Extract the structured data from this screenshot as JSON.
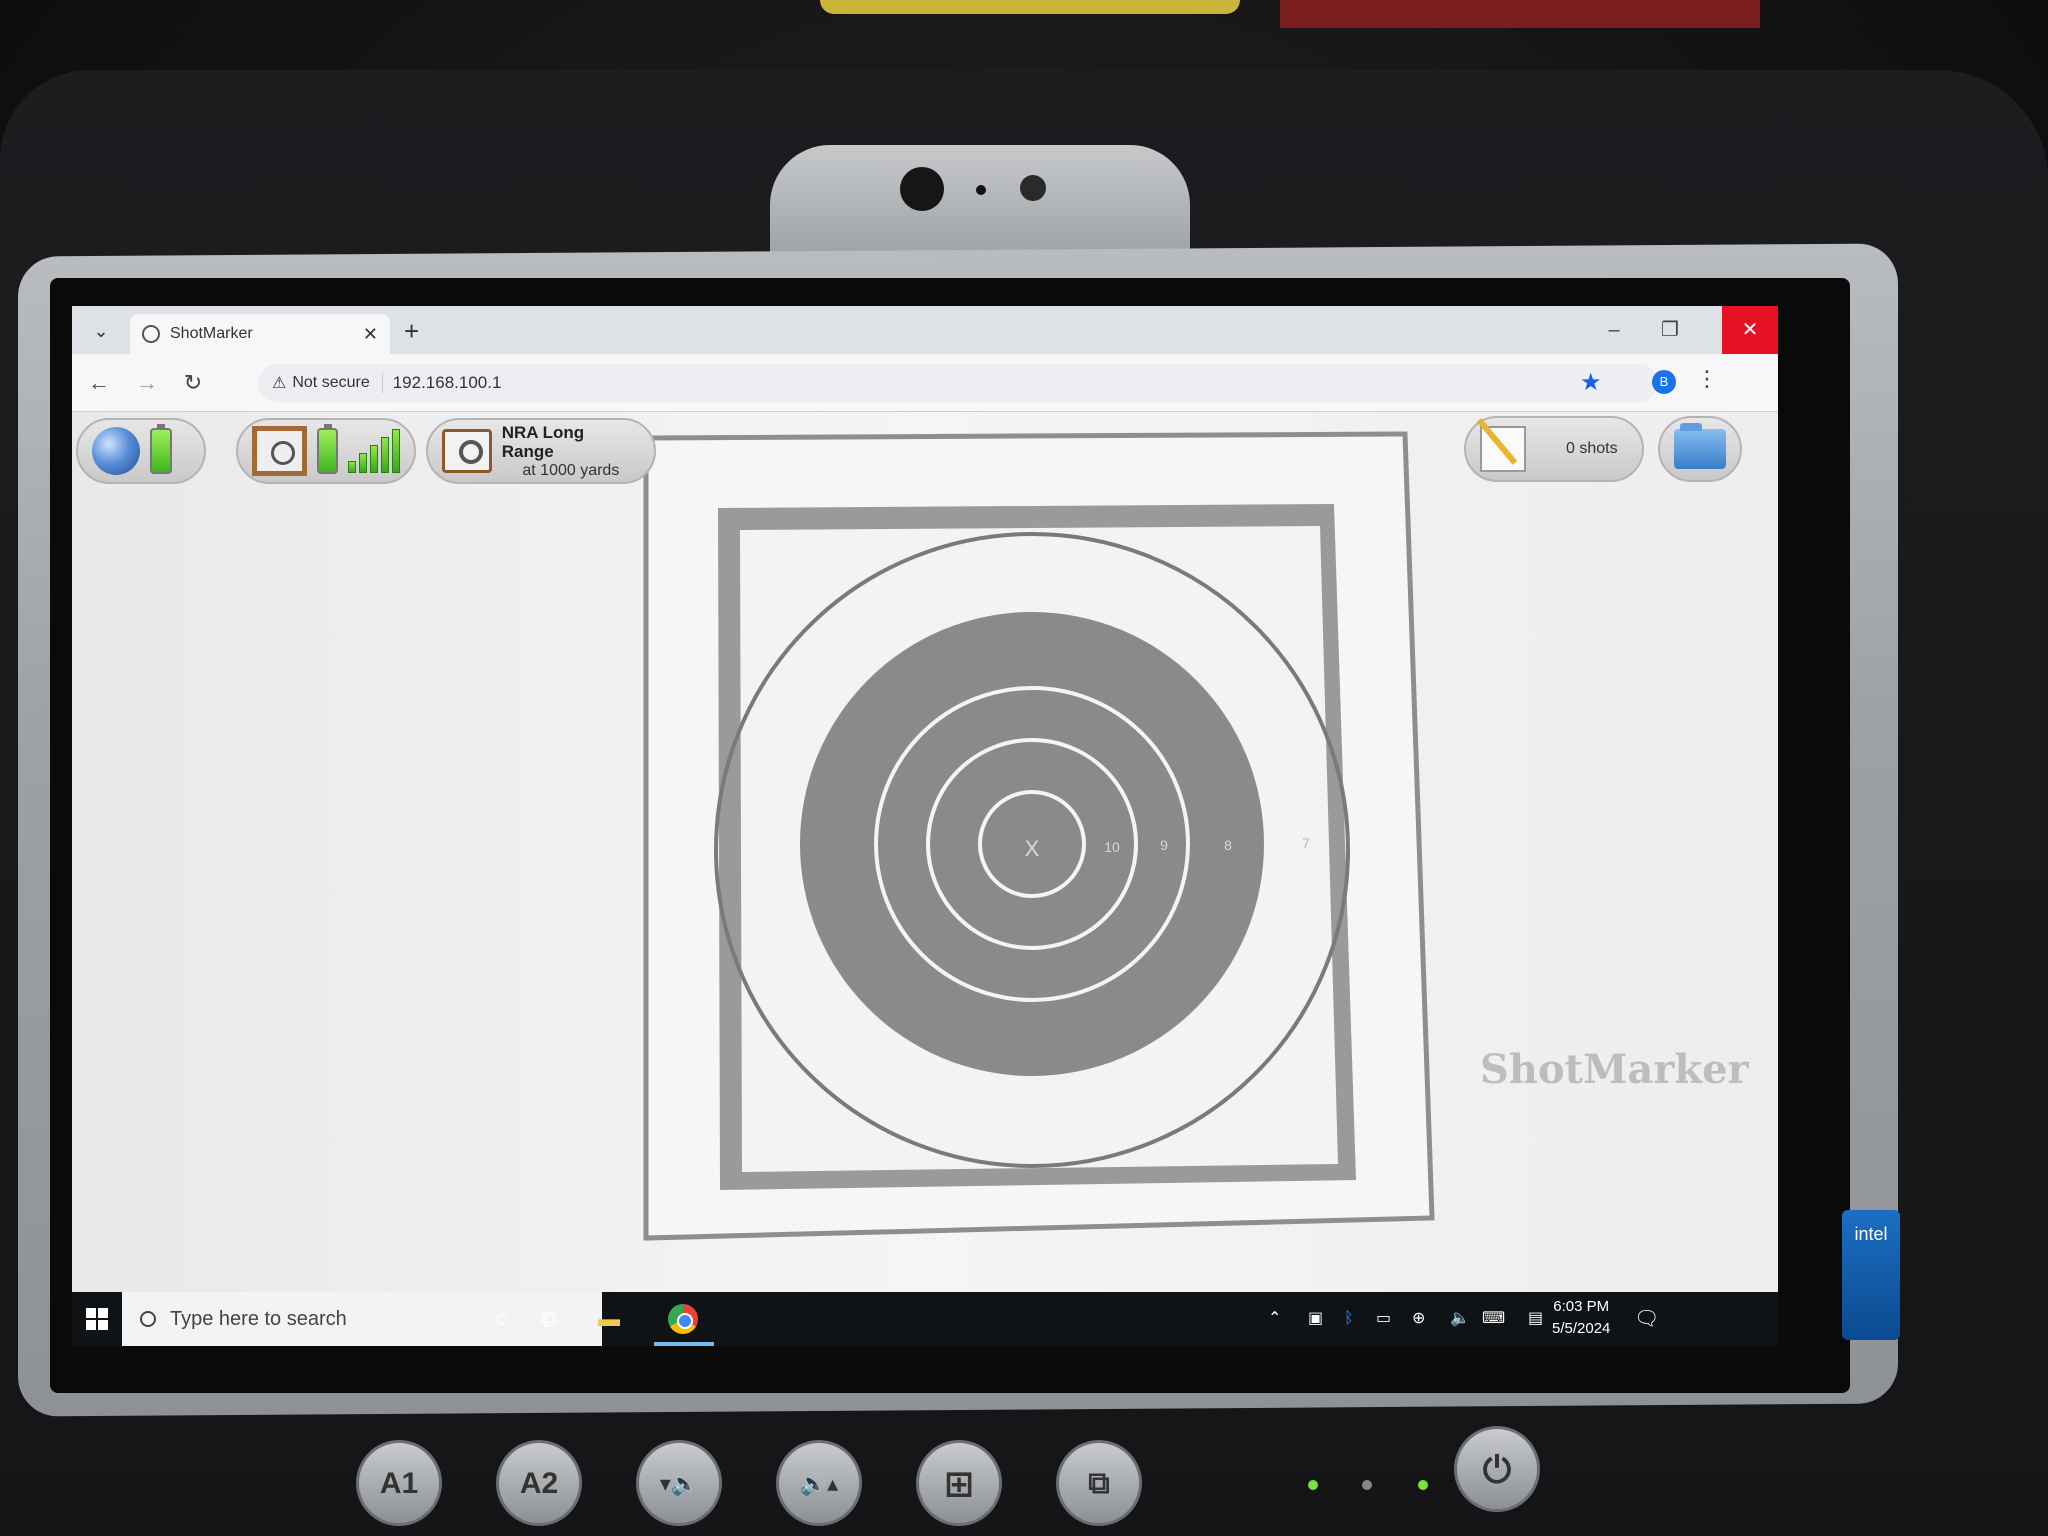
{
  "browser": {
    "tab_title": "ShotMarker",
    "new_tab": "+",
    "security_label": "Not secure",
    "url": "192.168.100.1",
    "profile_initial": "B",
    "colors": {
      "close": "#e81123",
      "star": "#1a5fe8"
    }
  },
  "toolbar": {
    "target_name": "NRA Long Range",
    "target_distance": "at 1000 yards",
    "shots_label": "0 shots"
  },
  "target": {
    "rings": [
      "X",
      "10",
      "9",
      "8",
      "7"
    ]
  },
  "watermark": "ShotMarker",
  "taskbar": {
    "search_placeholder": "Type here to search",
    "time": "6:03 PM",
    "date": "5/5/2024"
  },
  "hardware": {
    "a1": "A1",
    "a2": "A2"
  },
  "badge": "intel"
}
